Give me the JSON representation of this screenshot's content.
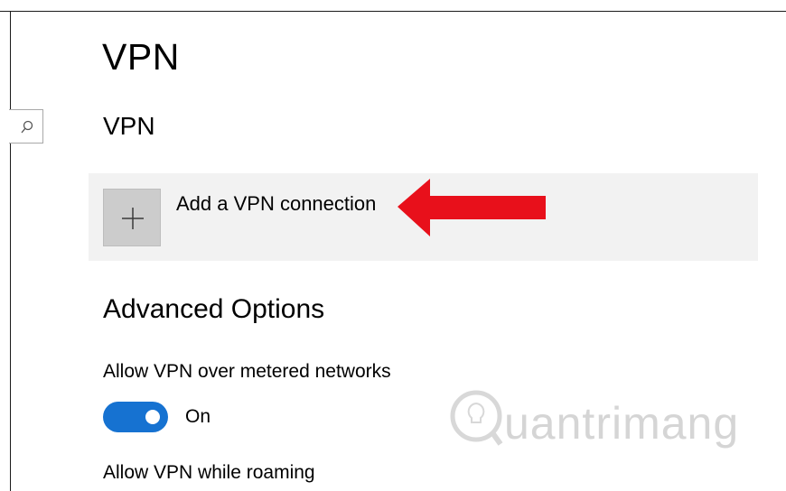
{
  "page": {
    "title": "VPN"
  },
  "search": {
    "icon": "search-icon"
  },
  "vpn_section": {
    "heading": "VPN",
    "add_connection_label": "Add a VPN connection",
    "add_icon": "plus-icon"
  },
  "annotation": {
    "icon": "red-arrow-icon",
    "color": "#e8101b"
  },
  "advanced": {
    "heading": "Advanced Options",
    "metered": {
      "label": "Allow VPN over metered networks",
      "state": "On",
      "on": true,
      "accent": "#1672d1"
    },
    "roaming": {
      "label": "Allow VPN while roaming"
    }
  },
  "watermark": {
    "text": "uantrimang",
    "icon": "lightbulb-q-logo-icon"
  }
}
